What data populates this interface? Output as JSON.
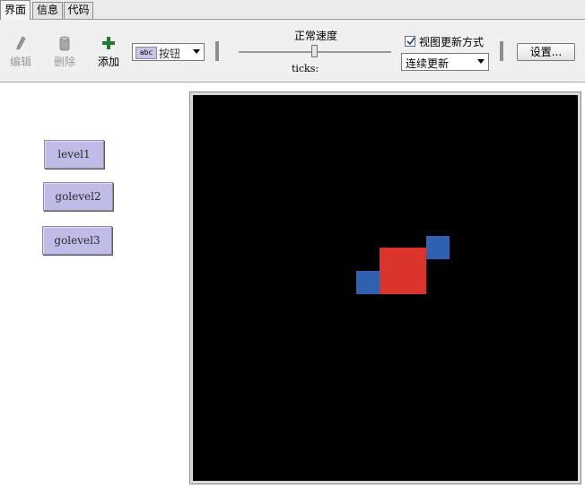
{
  "tabs": [
    {
      "label": "界面",
      "active": true
    },
    {
      "label": "信息",
      "active": false
    },
    {
      "label": "代码",
      "active": false
    }
  ],
  "toolbar": {
    "edit_label": "编辑",
    "delete_label": "删除",
    "add_label": "添加",
    "widget_type": {
      "icon": "abc",
      "selected": "按钮"
    },
    "speed_label": "正常速度",
    "ticks_label": "ticks:",
    "view_updates": {
      "checked": true,
      "label": "视图更新方式"
    },
    "update_mode": "连续更新",
    "settings_label": "设置..."
  },
  "interface_buttons": [
    {
      "label": "level1"
    },
    {
      "label": "golevel2"
    },
    {
      "label": "golevel3"
    }
  ],
  "world_view": {
    "background": "#000000",
    "patches": [
      {
        "color": "#d9332b",
        "role": "red-block"
      },
      {
        "color": "#3060b0",
        "role": "blue-block"
      },
      {
        "color": "#3060b0",
        "role": "blue-block"
      }
    ]
  },
  "colors": {
    "button_fill": "#bfbde8",
    "add_icon": "#1f7a2f"
  }
}
